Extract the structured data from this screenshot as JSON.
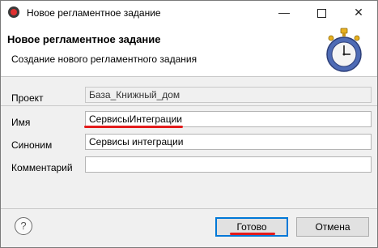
{
  "window": {
    "title": "Новое регламентное задание",
    "minimize": "—",
    "close": "✕"
  },
  "header": {
    "title": "Новое регламентное задание",
    "subtitle": "Создание нового регламентного задания",
    "icon": "stopwatch-icon"
  },
  "form": {
    "project_label": "Проект",
    "project_value": "База_Книжный_дом",
    "name_label": "Имя",
    "name_value": "СервисыИнтеграции",
    "synonym_label": "Синоним",
    "synonym_value": "Сервисы интеграции",
    "comment_label": "Комментарий",
    "comment_value": ""
  },
  "footer": {
    "help": "?",
    "finish_label": "Готово",
    "cancel_label": "Отмена"
  },
  "colors": {
    "accent": "#0078d7",
    "highlight": "#e31b1b"
  }
}
